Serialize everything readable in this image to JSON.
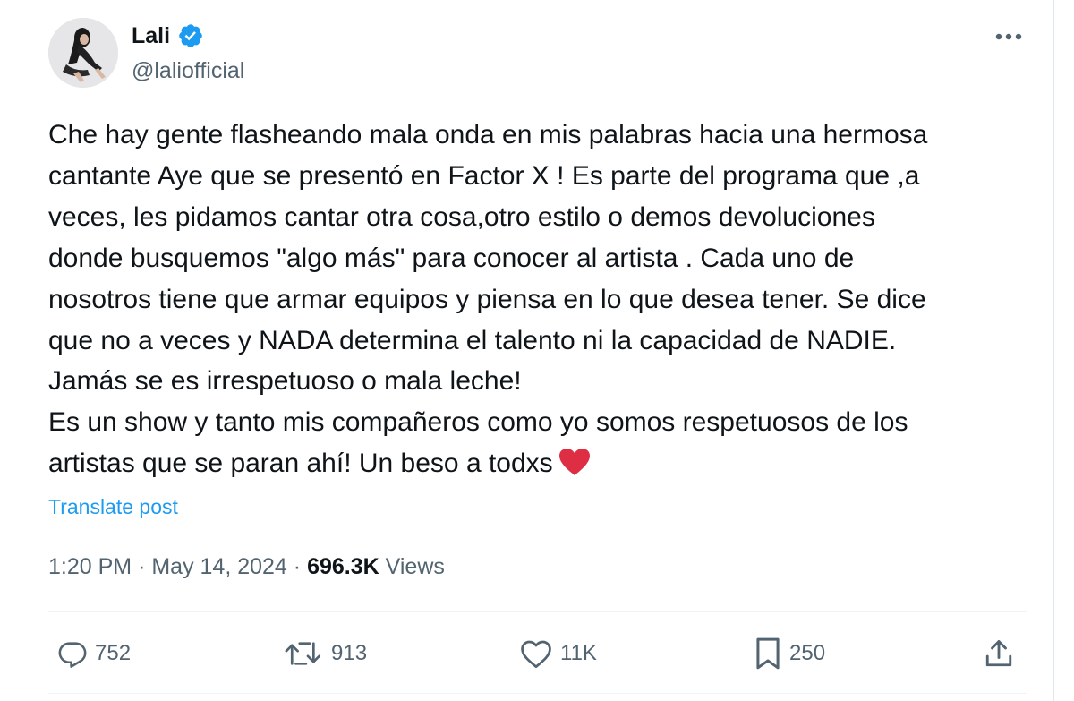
{
  "author": {
    "display_name": "Lali",
    "handle": "@laliofficial",
    "verified_icon": "verified-badge-icon",
    "avatar_icon": "avatar-photo"
  },
  "post": {
    "text": "Che hay gente flasheando mala onda en mis palabras hacia una hermosa\ncantante Aye que se presentó en Factor X ! Es parte del programa que ,a\nveces, les pidamos cantar otra cosa,otro estilo o demos devoluciones\ndonde busquemos \"algo más\" para conocer al artista . Cada uno de\nnosotros tiene que armar equipos y piensa en lo que desea tener. Se dice\nque no a veces y NADA determina el talento ni la capacidad de NADIE.\nJamás se es irrespetuoso o mala leche!\nEs un show y tanto mis compañeros como yo somos respetuosos de los\nartistas que se paran ahí! Un beso a todxs",
    "emoji": "red-heart",
    "translate_label": "Translate post",
    "time": "1:20 PM",
    "date": "May 14, 2024",
    "separator": "·",
    "views_count": "696.3K",
    "views_label": "Views"
  },
  "actions": {
    "replies": "752",
    "reposts": "913",
    "likes": "11K",
    "bookmarks": "250"
  },
  "colors": {
    "accent": "#1d9bf0",
    "text_primary": "#0f1419",
    "text_secondary": "#536471",
    "heart": "#e0245e"
  }
}
